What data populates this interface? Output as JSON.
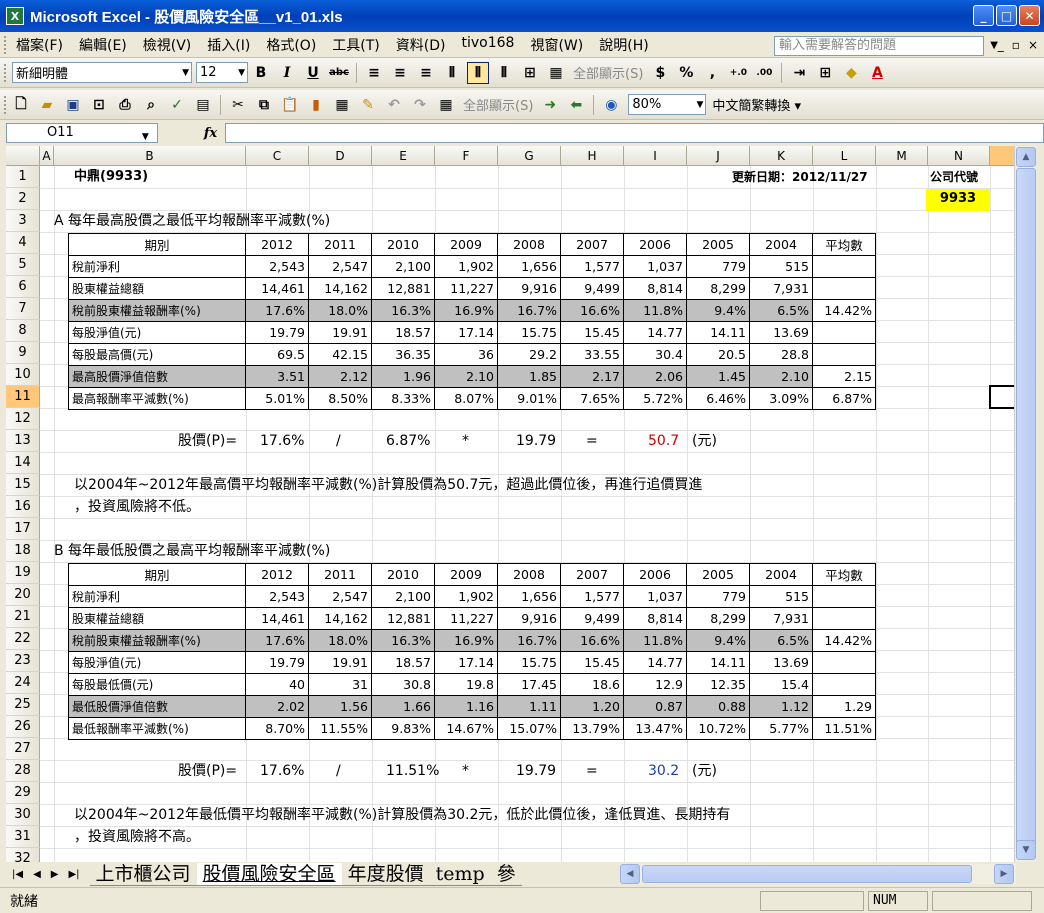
{
  "window": {
    "title": "Microsoft Excel - 股價風險安全區__v1_01.xls",
    "app_icon": "X"
  },
  "menu": {
    "items": [
      "檔案(F)",
      "編輯(E)",
      "檢視(V)",
      "插入(I)",
      "格式(O)",
      "工具(T)",
      "資料(D)",
      "tivo168",
      "視窗(W)",
      "說明(H)"
    ],
    "help_placeholder": "輸入需要解答的問題"
  },
  "toolbar1": {
    "font": "新細明體",
    "size": "12",
    "show_all": "全部顯示(S)"
  },
  "toolbar2": {
    "show_all": "全部顯示(S)",
    "zoom": "80%",
    "convert": "中文簡繁轉換"
  },
  "formula": {
    "cell_ref": "O11",
    "fx": "fx",
    "value": ""
  },
  "columns": [
    "A",
    "B",
    "C",
    "D",
    "E",
    "F",
    "G",
    "H",
    "I",
    "J",
    "K",
    "L",
    "M",
    "N"
  ],
  "selected_col": "O",
  "rows": [
    "1",
    "2",
    "3",
    "4",
    "5",
    "6",
    "7",
    "8",
    "9",
    "10",
    "11",
    "12",
    "13",
    "14",
    "15",
    "16",
    "17",
    "18",
    "19",
    "20",
    "21",
    "22",
    "23",
    "24",
    "25",
    "26",
    "27",
    "28",
    "29",
    "30",
    "31",
    "32"
  ],
  "selected_row": "11",
  "sheet": {
    "company": "中鼎(9933)",
    "update_date": "更新日期：2012/11/27",
    "code_label": "公司代號",
    "code_value": "9933",
    "section_a_title": "A  每年最高股價之最低平均報酬率平減數(%)",
    "section_b_title": "B  每年最低股價之最高平均報酬率平減數(%)",
    "headers": [
      "期別",
      "2012",
      "2011",
      "2010",
      "2009",
      "2008",
      "2007",
      "2006",
      "2005",
      "2004",
      "平均數"
    ],
    "table_a": [
      [
        "稅前淨利",
        "2,543",
        "2,547",
        "2,100",
        "1,902",
        "1,656",
        "1,577",
        "1,037",
        "779",
        "515",
        ""
      ],
      [
        "股東權益總額",
        "14,461",
        "14,162",
        "12,881",
        "11,227",
        "9,916",
        "9,499",
        "8,814",
        "8,299",
        "7,931",
        ""
      ],
      [
        "稅前股東權益報酬率(%)",
        "17.6%",
        "18.0%",
        "16.3%",
        "16.9%",
        "16.7%",
        "16.6%",
        "11.8%",
        "9.4%",
        "6.5%",
        "14.42%"
      ],
      [
        "每股淨值(元)",
        "19.79",
        "19.91",
        "18.57",
        "17.14",
        "15.75",
        "15.45",
        "14.77",
        "14.11",
        "13.69",
        ""
      ],
      [
        "每股最高價(元)",
        "69.5",
        "42.15",
        "36.35",
        "36",
        "29.2",
        "33.55",
        "30.4",
        "20.5",
        "28.8",
        ""
      ],
      [
        "最高股價淨值倍數",
        "3.51",
        "2.12",
        "1.96",
        "2.10",
        "1.85",
        "2.17",
        "2.06",
        "1.45",
        "2.10",
        "2.15"
      ],
      [
        "最高報酬率平減數(%)",
        "5.01%",
        "8.50%",
        "8.33%",
        "8.07%",
        "9.01%",
        "7.65%",
        "5.72%",
        "6.46%",
        "3.09%",
        "6.87%"
      ]
    ],
    "table_b": [
      [
        "稅前淨利",
        "2,543",
        "2,547",
        "2,100",
        "1,902",
        "1,656",
        "1,577",
        "1,037",
        "779",
        "515",
        ""
      ],
      [
        "股東權益總額",
        "14,461",
        "14,162",
        "12,881",
        "11,227",
        "9,916",
        "9,499",
        "8,814",
        "8,299",
        "7,931",
        ""
      ],
      [
        "稅前股東權益報酬率(%)",
        "17.6%",
        "18.0%",
        "16.3%",
        "16.9%",
        "16.7%",
        "16.6%",
        "11.8%",
        "9.4%",
        "6.5%",
        "14.42%"
      ],
      [
        "每股淨值(元)",
        "19.79",
        "19.91",
        "18.57",
        "17.14",
        "15.75",
        "15.45",
        "14.77",
        "14.11",
        "13.69",
        ""
      ],
      [
        "每股最低價(元)",
        "40",
        "31",
        "30.8",
        "19.8",
        "17.45",
        "18.6",
        "12.9",
        "12.35",
        "15.4",
        ""
      ],
      [
        "最低股價淨值倍數",
        "2.02",
        "1.56",
        "1.66",
        "1.16",
        "1.11",
        "1.20",
        "0.87",
        "0.88",
        "1.12",
        "1.29"
      ],
      [
        "最低報酬率平減數(%)",
        "8.70%",
        "11.55%",
        "9.83%",
        "14.67%",
        "15.07%",
        "13.79%",
        "13.47%",
        "10.72%",
        "5.77%",
        "11.51%"
      ]
    ],
    "formula_a": {
      "label": "股價(P)=",
      "roe": "17.6%",
      "op1": "/",
      "rate": "6.87%",
      "op2": "*",
      "nav": "19.79",
      "eq": "=",
      "result": "50.7",
      "unit": "(元)"
    },
    "formula_b": {
      "label": "股價(P)=",
      "roe": "17.6%",
      "op1": "/",
      "rate": "11.51%",
      "op2": "*",
      "nav": "19.79",
      "eq": "=",
      "result": "30.2",
      "unit": "(元)"
    },
    "note_a_1": "以2004年~2012年最高價平均報酬率平減數(%)計算股價為50.7元，超過此價位後，再進行追價買進",
    "note_a_2": "，投資風險將不低。",
    "note_b_1": "以2004年~2012年最低價平均報酬率平減數(%)計算股價為30.2元，低於此價位後，逢低買進、長期持有",
    "note_b_2": "，投資風險將不高。",
    "colors": {
      "result_a": "#cc0000",
      "result_b": "#1f3f9f",
      "code_bg": "#ffff00",
      "gray_row": "#c0c0c0"
    }
  },
  "tabs": [
    "上市櫃公司",
    "股價風險安全區",
    "年度股價",
    "temp",
    "參"
  ],
  "status": {
    "text": "就緒",
    "num": "NUM"
  }
}
